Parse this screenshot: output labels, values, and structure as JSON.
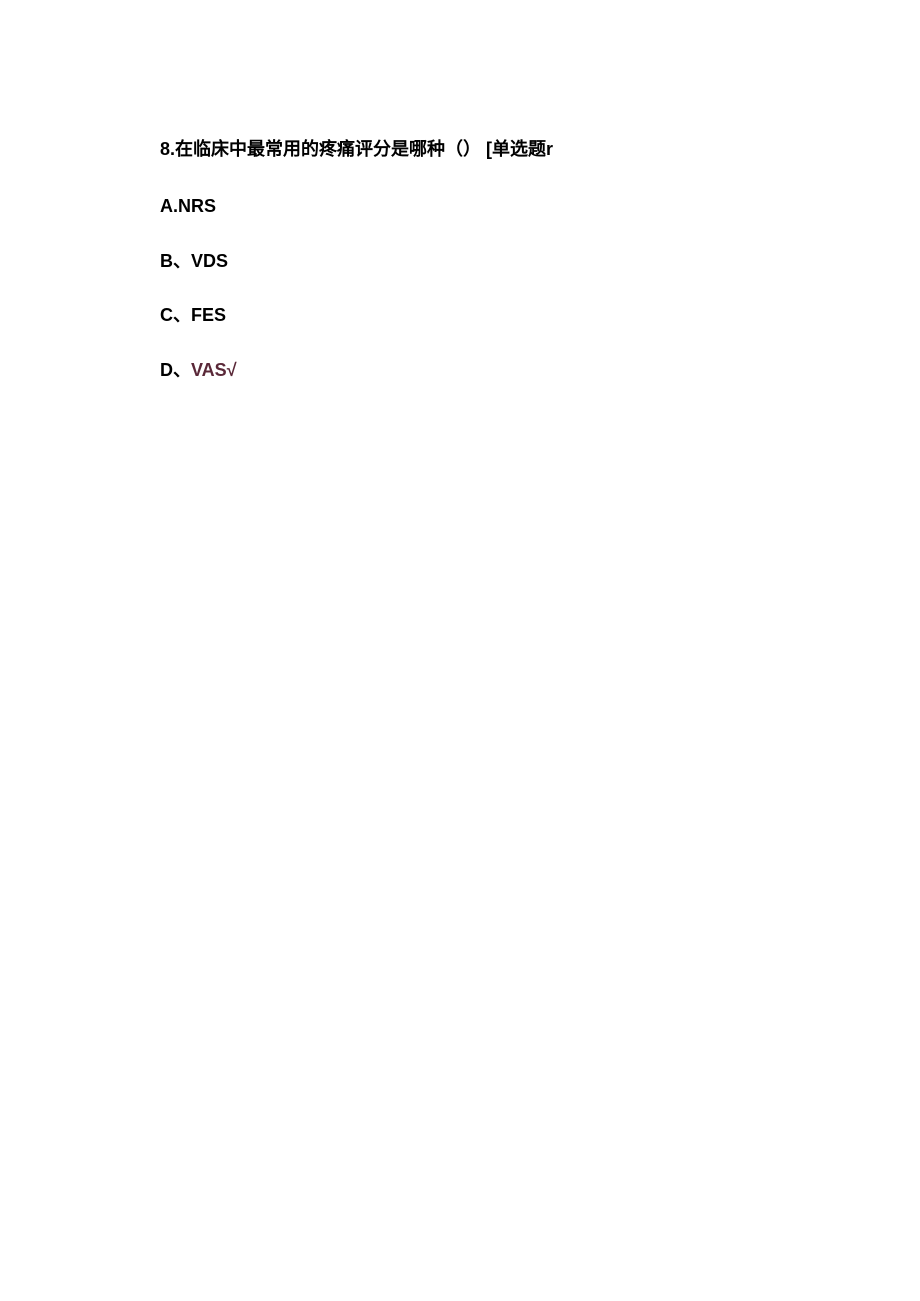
{
  "question": {
    "number": "8.",
    "stem": "在临床中最常用的疼痛评分是哪种（）",
    "type_label": "[单选题r"
  },
  "options": [
    {
      "letter": "A.",
      "text": "NRS",
      "correct": false
    },
    {
      "letter": "B、",
      "text": "VDS",
      "correct": false
    },
    {
      "letter": "C、",
      "text": "FES",
      "correct": false
    },
    {
      "letter": "D、",
      "text": "VAS",
      "correct": true,
      "mark": "√"
    }
  ]
}
